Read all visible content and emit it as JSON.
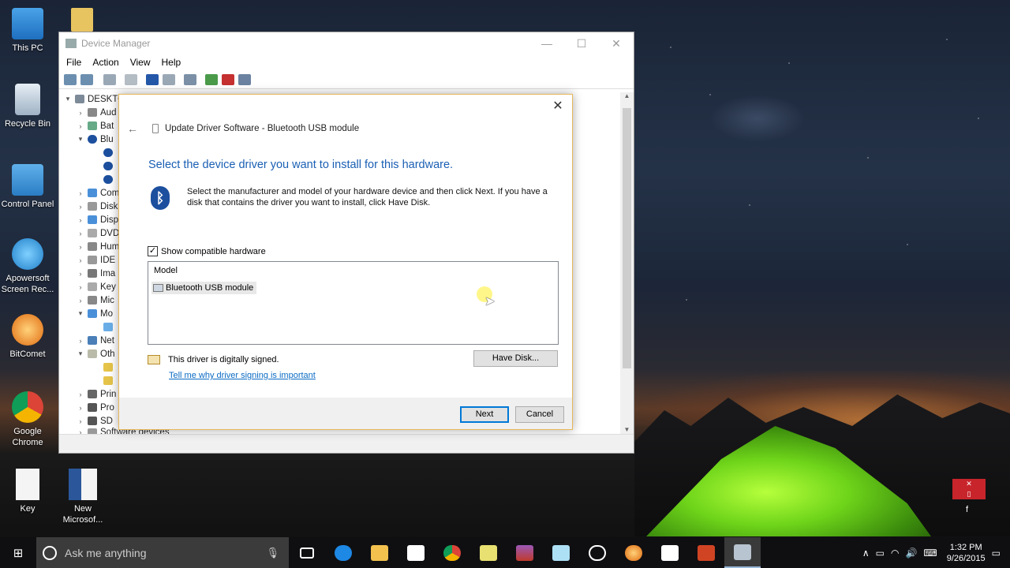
{
  "desktop": {
    "icons": [
      {
        "label": "This PC"
      },
      {
        "label": "Recycle Bin"
      },
      {
        "label": "Control Panel"
      },
      {
        "label": "Apowersoft Screen Rec..."
      },
      {
        "label": "BitComet"
      },
      {
        "label": "Google Chrome"
      },
      {
        "label": "Key"
      },
      {
        "label": "New Microsof..."
      }
    ],
    "folder_icon": "folder-icon",
    "notif_label": "f"
  },
  "device_manager": {
    "title": "Device Manager",
    "window_buttons": {
      "minimize": "—",
      "maximize": "☐",
      "close": "✕"
    },
    "menu": [
      "File",
      "Action",
      "View",
      "Help"
    ],
    "tree": {
      "root": "DESKTO",
      "items": [
        "Aud",
        "Bat",
        "Blu",
        "",
        "",
        "",
        "Com",
        "Disk",
        "Disp",
        "DVD",
        "Hum",
        "IDE",
        "Ima",
        "Key",
        "Mic",
        "Mo",
        "",
        "Net",
        "Oth",
        "",
        "",
        "Prin",
        "Pro",
        "SD",
        "Software devices"
      ]
    }
  },
  "dialog": {
    "header": "Update Driver Software - Bluetooth USB module",
    "heading": "Select the device driver you want to install for this hardware.",
    "description": "Select the manufacturer and model of your hardware device and then click Next. If you have a disk that contains the driver you want to install, click Have Disk.",
    "show_compatible": "Show compatible hardware",
    "model_header": "Model",
    "models": [
      "Bluetooth USB module"
    ],
    "signed_text": "This driver is digitally signed.",
    "signing_link": "Tell me why driver signing is important",
    "have_disk": "Have Disk...",
    "next": "Next",
    "cancel": "Cancel"
  },
  "taskbar": {
    "search_placeholder": "Ask me anything",
    "time": "1:32 PM",
    "date": "9/26/2015"
  },
  "colors": {
    "heading_blue": "#1a5fb4",
    "link_blue": "#0b6bc3",
    "accent": "#0078d7"
  }
}
